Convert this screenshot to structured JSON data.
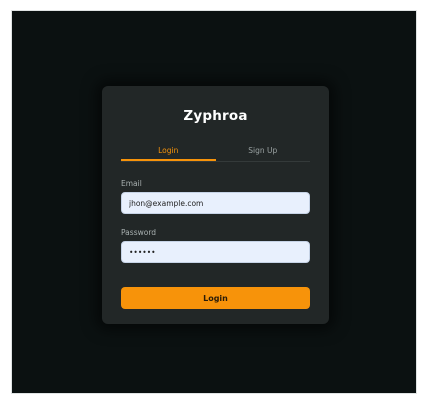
{
  "app": {
    "name": "Zyphroa"
  },
  "tabs": [
    {
      "label": "Login",
      "active": true
    },
    {
      "label": "Sign Up",
      "active": false
    }
  ],
  "form": {
    "email_label": "Email",
    "email_value": "jhon@example.com",
    "password_label": "Password",
    "password_value": "••••••",
    "submit_label": "Login"
  },
  "colors": {
    "accent": "#f7930a",
    "background": "#0b1111",
    "card": "#222727",
    "input_bg": "#e8f0fd"
  }
}
